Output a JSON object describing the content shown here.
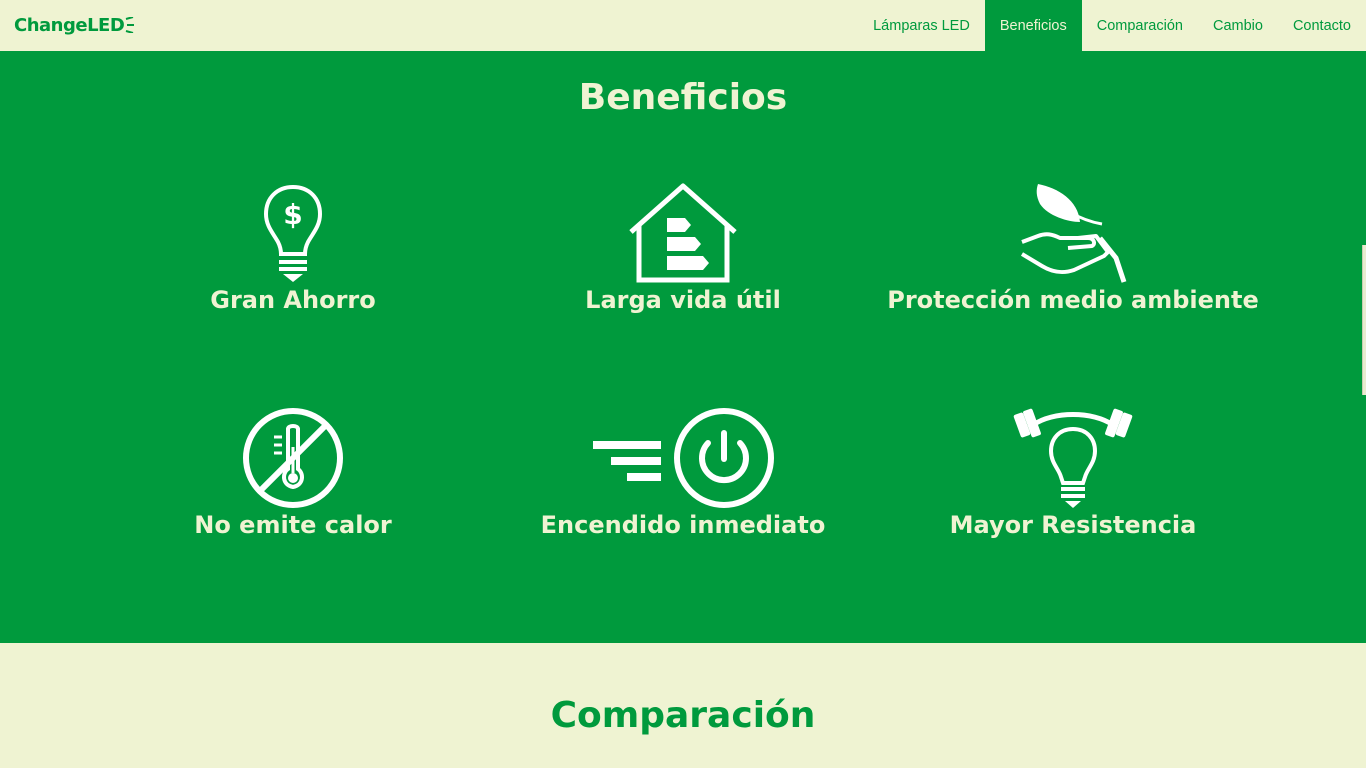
{
  "brand": {
    "name": "ChangeLED",
    "color": "#009a3d",
    "background": "#eff3d2"
  },
  "nav": {
    "items": [
      {
        "label": "Lámparas LED"
      },
      {
        "label": "Beneficios",
        "active": true
      },
      {
        "label": "Comparación"
      },
      {
        "label": "Cambio"
      },
      {
        "label": "Contacto"
      }
    ]
  },
  "benefits": {
    "title": "Beneficios",
    "items": [
      {
        "label": "Gran Ahorro",
        "icon": "dollar-bulb-icon"
      },
      {
        "label": "Larga vida útil",
        "icon": "energy-house-icon"
      },
      {
        "label": "Protección medio ambiente",
        "icon": "leaf-hand-icon"
      },
      {
        "label": "No emite calor",
        "icon": "no-heat-thermometer-icon"
      },
      {
        "label": "Encendido inmediato",
        "icon": "power-icon"
      },
      {
        "label": "Mayor Resistencia",
        "icon": "strong-bulb-icon"
      }
    ]
  },
  "comparison": {
    "title": "Comparación"
  }
}
